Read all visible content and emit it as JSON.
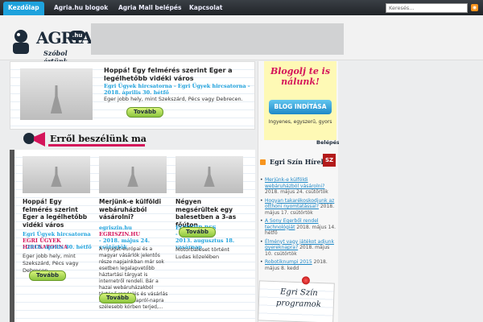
{
  "nav": {
    "items": [
      {
        "label": "Kezdőlap",
        "active": true
      },
      {
        "label": "Agria.hu blogok"
      },
      {
        "label": "Agria Mall belépés"
      },
      {
        "label": "Kapcsolat"
      }
    ],
    "search_placeholder": "Keresés..."
  },
  "logo": {
    "text": "AGRIA",
    "domain": ".hu",
    "slogan": "Szóbol értünk"
  },
  "featured": {
    "title": "Hoppá! Egy felmérés szerint Eger a legélhetőbb vidéki város",
    "meta": "Egri Ügyek hircsatorna - Egri Ügyek hircsatorna - 2018. április 30. hétfő",
    "excerpt": "Eger jobb hely, mint Szekszárd, Pécs vagy Debrecen.",
    "button": "Tovább"
  },
  "section": {
    "title": "Erről beszélünk ma"
  },
  "articles": [
    {
      "title": "Hoppá! Egy felmérés szerint Eger a legélhetőbb vidéki város",
      "meta1": "Egri Ügyek hircsatorna",
      "meta2": "EGRI ÜGYEK HIRCSATORNA",
      "meta3": "- 2018. április 30. hétfő",
      "excerpt": "Eger jobb hely, mint Szekszárd, Pécs vagy Debrecen.",
      "button": "Tovább"
    },
    {
      "title": "Merjünk-e külföldi webáruházból vásárolni?",
      "meta1": "egriszin.hu",
      "meta2": "EGRISZIN.HU",
      "meta3": "- 2018. május 24. csütörtök",
      "excerpt": "A nyugat-európai és a magyar vásárlók jelentős része napjainkban már sok esetben legalapvetőbb háztartási tárgyat is internetről rendeli. Bár a hazai webáruházakból történő rendelés és vásárlás lebonyolítása napról-napra szélesebb körben terjed,...",
      "button": "Tovább"
    },
    {
      "title": "Négyen megsérültek egy balesetben a 3-as főúton",
      "meta1": "EGRIHIR RSS",
      "meta2": "-",
      "meta3": "2013. augusztus 18. vasárnap",
      "excerpt": "Motorbaleset történt Ludas közelében",
      "button": "Tovább"
    }
  ],
  "sidebar": {
    "blog_title": "Blogolj te is nálunk!",
    "blog_button": "BLOG INDÍTÁSA",
    "blog_sub": "Ingyenes, egyszerű, gyors",
    "login": "Belépés",
    "news_title": "Egri Szín Hírek",
    "news_icon": "SZ",
    "news": [
      {
        "link": "Merjünk-e külföldi webáruházból vásárolni?",
        "date": "2018. május 24. csütörtök"
      },
      {
        "link": "Hogyan takarékoskodjunk az otthoni nyomtatással?",
        "date": "2018. május 17. csütörtök"
      },
      {
        "link": "A Sony Egerből rendel technológiát",
        "date": "2018. május 14. hétfő"
      },
      {
        "link": "Élményt vagy játékot adjunk gyereknapra?",
        "date": "2018. május 10. csütörtök"
      },
      {
        "link": "Robotiknumpi 2015",
        "date": "2018. május 8. kedd"
      }
    ],
    "program_title": "Egri Szín programok"
  }
}
